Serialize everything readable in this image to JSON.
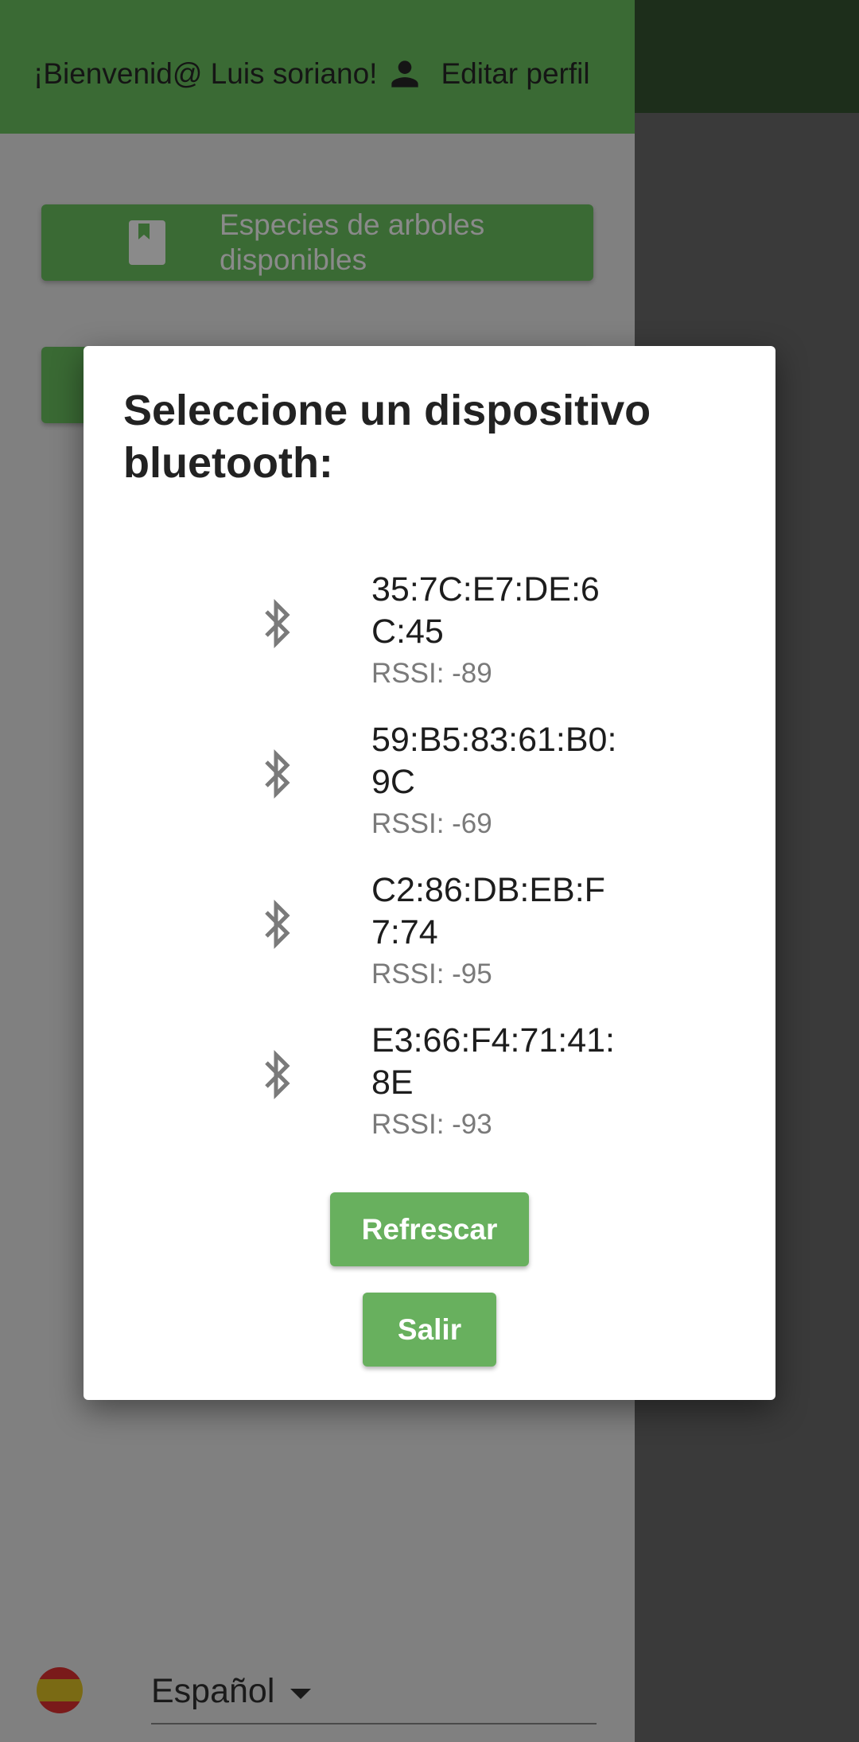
{
  "drawer": {
    "welcome": "¡Bienvenid@ Luis soriano!",
    "edit_profile": "Editar perfil",
    "menu": [
      {
        "label": "Especies de arboles disponibles",
        "icon": "book-icon"
      }
    ],
    "language": "Español"
  },
  "dialog": {
    "title": "Seleccione un dispositivo bluetooth:",
    "devices": [
      {
        "address": "35:7C:E7:DE:6C:45",
        "rssi": "RSSI: -89"
      },
      {
        "address": "59:B5:83:61:B0:9C",
        "rssi": "RSSI: -69"
      },
      {
        "address": "C2:86:DB:EB:F7:74",
        "rssi": "RSSI: -95"
      },
      {
        "address": "E3:66:F4:71:41:8E",
        "rssi": "RSSI: -93"
      }
    ],
    "refresh_button": "Refrescar",
    "exit_button": "Salir"
  },
  "colors": {
    "primary_green": "#3a6a34",
    "button_green": "#68b05e",
    "scrim": "#808080"
  }
}
